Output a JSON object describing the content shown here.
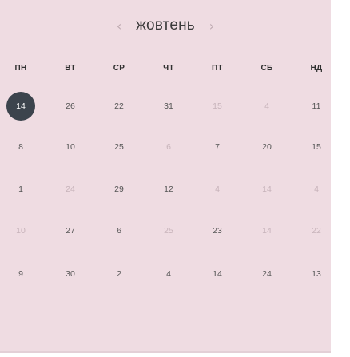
{
  "calendar": {
    "month": "жовтень",
    "prev_icon": "chevron-left-icon",
    "next_icon": "chevron-right-icon",
    "weekdays": [
      "пн",
      "вт",
      "ср",
      "чт",
      "пт",
      "сб",
      "нд"
    ],
    "rows": [
      [
        {
          "d": "14",
          "state": "selected"
        },
        {
          "d": "26",
          "state": "normal"
        },
        {
          "d": "22",
          "state": "normal"
        },
        {
          "d": "31",
          "state": "normal"
        },
        {
          "d": "15",
          "state": "muted"
        },
        {
          "d": "4",
          "state": "muted"
        },
        {
          "d": "11",
          "state": "normal"
        }
      ],
      [
        {
          "d": "8",
          "state": "normal"
        },
        {
          "d": "10",
          "state": "normal"
        },
        {
          "d": "25",
          "state": "normal"
        },
        {
          "d": "6",
          "state": "muted"
        },
        {
          "d": "7",
          "state": "normal"
        },
        {
          "d": "20",
          "state": "normal"
        },
        {
          "d": "15",
          "state": "normal"
        }
      ],
      [
        {
          "d": "1",
          "state": "normal"
        },
        {
          "d": "24",
          "state": "muted"
        },
        {
          "d": "29",
          "state": "normal"
        },
        {
          "d": "12",
          "state": "normal"
        },
        {
          "d": "4",
          "state": "muted"
        },
        {
          "d": "14",
          "state": "muted"
        },
        {
          "d": "4",
          "state": "muted"
        }
      ],
      [
        {
          "d": "10",
          "state": "muted"
        },
        {
          "d": "27",
          "state": "normal"
        },
        {
          "d": "6",
          "state": "normal"
        },
        {
          "d": "25",
          "state": "muted"
        },
        {
          "d": "23",
          "state": "normal"
        },
        {
          "d": "14",
          "state": "muted"
        },
        {
          "d": "22",
          "state": "muted"
        }
      ],
      [
        {
          "d": "9",
          "state": "normal"
        },
        {
          "d": "30",
          "state": "normal"
        },
        {
          "d": "2",
          "state": "normal"
        },
        {
          "d": "4",
          "state": "normal"
        },
        {
          "d": "14",
          "state": "normal"
        },
        {
          "d": "24",
          "state": "normal"
        },
        {
          "d": "13",
          "state": "normal"
        }
      ]
    ]
  },
  "colors": {
    "background": "#efdce2",
    "selected": "#3c444d",
    "muted_text": "#c7b3ba"
  }
}
